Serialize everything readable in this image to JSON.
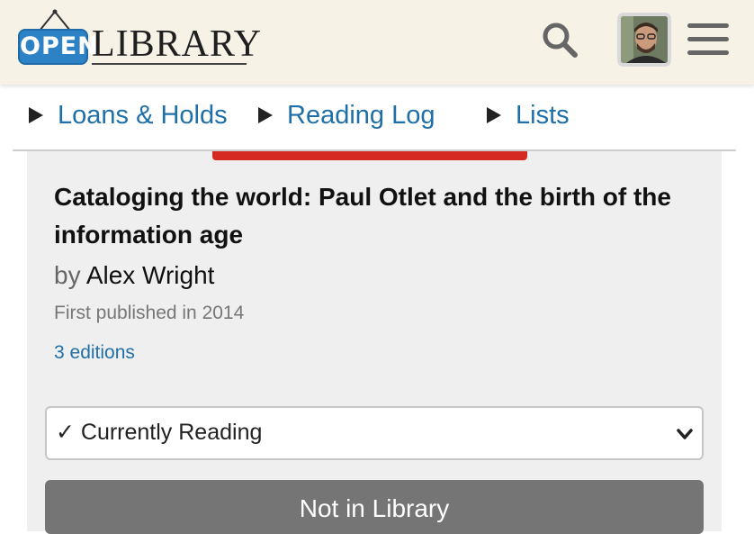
{
  "header": {
    "logo_open": "OPEN",
    "logo_library": "LIBRARY"
  },
  "nav": {
    "items": [
      {
        "label": "Loans & Holds"
      },
      {
        "label": "Reading Log"
      },
      {
        "label": "Lists"
      }
    ]
  },
  "book": {
    "title": "Cataloging the world: Paul Otlet and the birth of the information age",
    "by": "by",
    "author": "Alex Wright",
    "first_published": "First published in 2014",
    "editions": "3 editions"
  },
  "reading_status": {
    "selected": "✓ Currently Reading"
  },
  "availability_button": {
    "label": "Not in Library"
  },
  "icons": {
    "search": "search-icon",
    "menu": "hamburger-menu-icon",
    "avatar": "user-avatar",
    "dropdown": "chevron-down-icon",
    "nav_expand": "triangle-right-icon"
  },
  "colors": {
    "header_bg": "#f6f2e6",
    "link": "#1f6fa8",
    "logo_blue": "#2d82c6",
    "cover_red": "#d42a22",
    "card_bg": "#efefef",
    "button_gray": "#757575"
  }
}
